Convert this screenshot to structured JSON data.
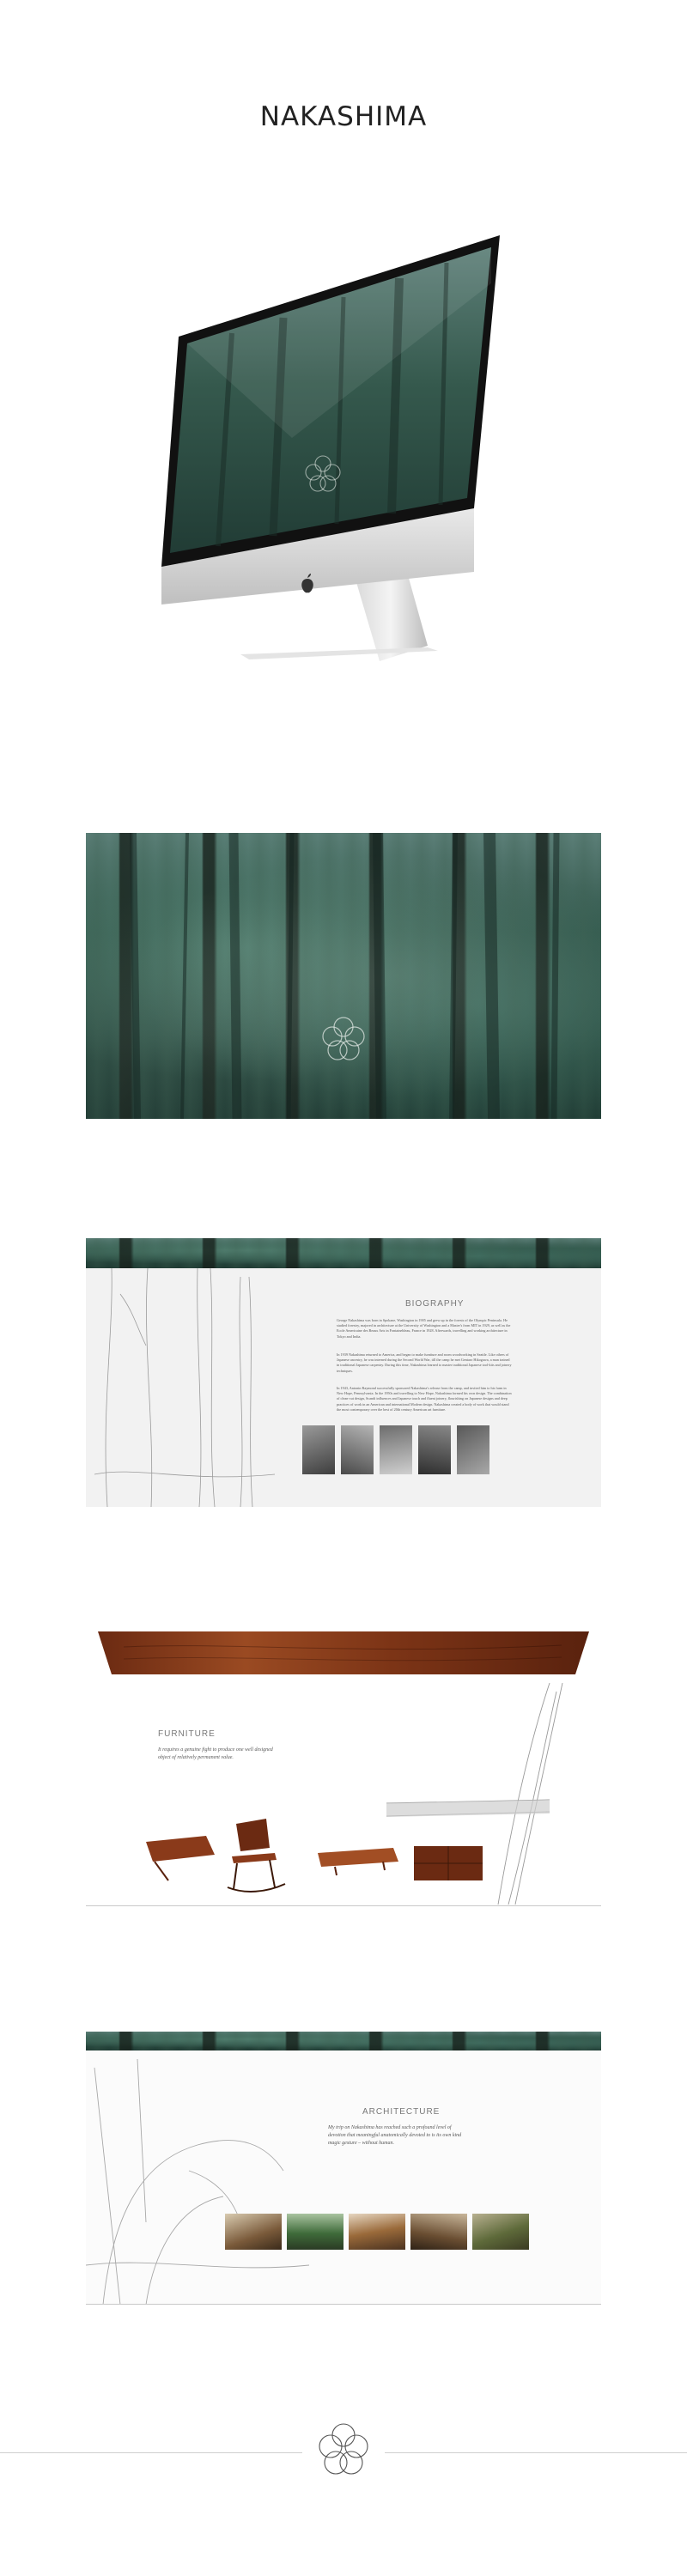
{
  "page": {
    "title": "NAKASHIMA"
  },
  "icons": {
    "apple": "apple-logo-icon",
    "flower": "nakashima-flower-logo-icon"
  },
  "colors": {
    "forest_dark": "#27483e",
    "forest_light": "#5c7f78",
    "wood": "#8a3a1a",
    "panel": "#f2f2f2"
  },
  "biography": {
    "heading": "BIOGRAPHY",
    "paragraphs": [
      "George Nakashima was born in Spokane, Washington in 1905 and grew up in the forests of the Olympic Peninsula. He studied forestry, majored in architecture at the University of Washington and a Master's from MIT in 1929, as well as the Ecole Americaine des Beaux Arts in Fontainebleau, France in 1928. Afterwards, travelling and working architecture in Tokyo and India.",
      "In 1939 Nakashima returned to America, and began to make furniture and room woodworking in Seattle. Like others of Japanese ancestry, he was interned during the Second World War, till the camp he met Gentaro Hikogawa, a man trained in traditional Japanese carpentry. During this time, Nakashima learned to master traditional Japanese tool-kits and joinery techniques.",
      "In 1943, Antonin Raymond successfully sponsored Nakashima's release from the camp, and invited him to his farm in New Hope, Pennsylvania. In the 1950s and travelling to New Hope, Nakashima formed his own design. The combination of clean-cut design, Scandi influences and Japanese touch and fluent joinery, flourishing on Japanese designs and deep practices of work in an American and international Modern design. Nakashima created a body of work that would stand the most contemporary over the best of 20th century American art furniture."
    ]
  },
  "furniture": {
    "heading": "FURNITURE",
    "tagline": "It requires a genuine fight to produce one well designed object of relatively permanent value."
  },
  "architecture": {
    "heading": "ARCHITECTURE",
    "tagline": "My trip on Nakashima has reached such a profound level of devotion that meaningful anatomically devoted to is its own kind magic gesture – without human."
  }
}
